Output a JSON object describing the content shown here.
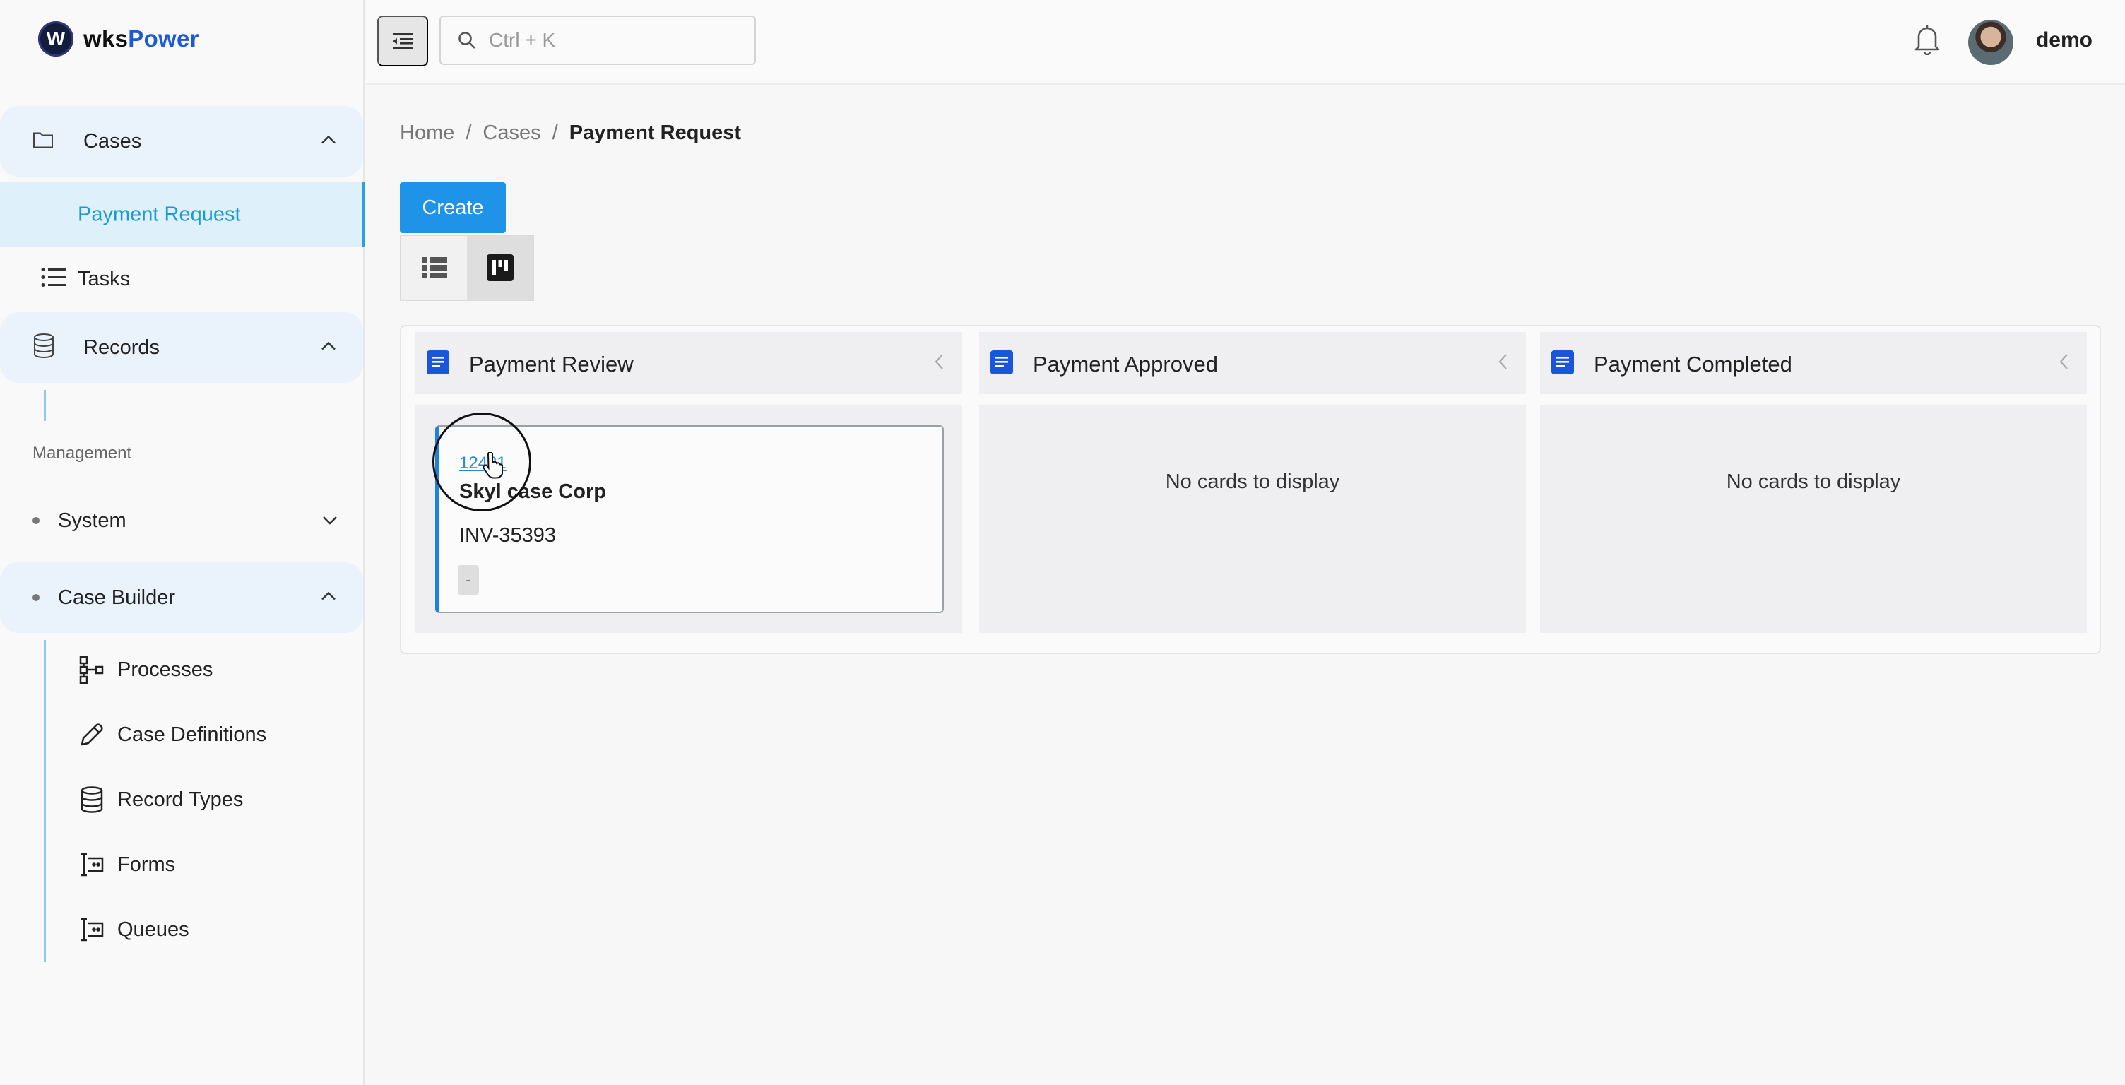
{
  "brand": {
    "name_part1": "wks",
    "name_part2": "Power",
    "mark": "W"
  },
  "sidebar": {
    "cases_label": "Cases",
    "payment_request_label": "Payment Request",
    "tasks_label": "Tasks",
    "records_label": "Records",
    "section_management": "Management",
    "system_label": "System",
    "case_builder_label": "Case Builder",
    "case_builder_items": [
      {
        "label": "Processes",
        "icon": "processes-icon"
      },
      {
        "label": "Case Definitions",
        "icon": "pencil-icon"
      },
      {
        "label": "Record Types",
        "icon": "database-icon"
      },
      {
        "label": "Forms",
        "icon": "form-icon"
      },
      {
        "label": "Queues",
        "icon": "queue-icon"
      }
    ]
  },
  "topbar": {
    "search_placeholder": "Ctrl + K",
    "username": "demo"
  },
  "breadcrumb": {
    "home": "Home",
    "sep": "/",
    "cases": "Cases",
    "current": "Payment Request"
  },
  "actions": {
    "create_label": "Create"
  },
  "board": {
    "columns": [
      {
        "title": "Payment Review"
      },
      {
        "title": "Payment Approved",
        "empty_text": "No cards to display"
      },
      {
        "title": "Payment Completed",
        "empty_text": "No cards to display"
      }
    ],
    "card": {
      "id": "12431",
      "name": "Skyl case Corp",
      "invoice": "INV-35393",
      "tag": "-"
    }
  },
  "colors": {
    "accent": "#1f93e8",
    "active_nav_bg": "#def1fa",
    "active_nav_text": "#1d9ad6",
    "doc_icon": "#1a56db"
  }
}
